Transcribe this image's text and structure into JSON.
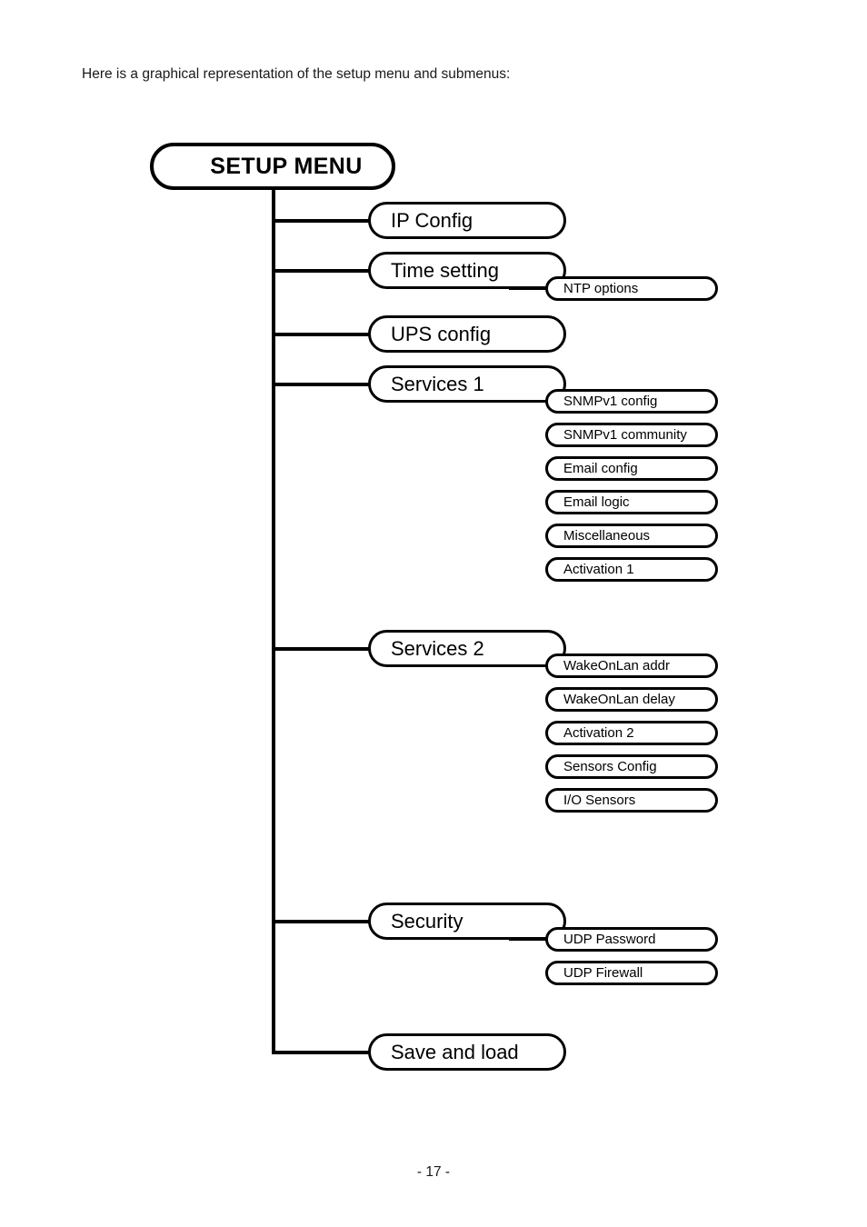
{
  "document": {
    "intro_text": "Here is a graphical representation of the setup menu and submenus:",
    "page_number": "- 17 -"
  },
  "diagram": {
    "root": {
      "label": "SETUP MENU"
    },
    "menu": [
      {
        "label": "IP Config",
        "submenu": []
      },
      {
        "label": "Time setting",
        "submenu": [
          "NTP options"
        ]
      },
      {
        "label": "UPS config",
        "submenu": []
      },
      {
        "label": "Services 1",
        "submenu": [
          "SNMPv1 config",
          "SNMPv1 community",
          "Email config",
          "Email logic",
          "Miscellaneous",
          "Activation 1"
        ]
      },
      {
        "label": "Services 2",
        "submenu": [
          "WakeOnLan addr",
          "WakeOnLan delay",
          "Activation 2",
          "Sensors Config",
          "I/O Sensors"
        ]
      },
      {
        "label": "Security",
        "submenu": [
          "UDP Password",
          "UDP Firewall"
        ]
      },
      {
        "label": "Save and load",
        "submenu": []
      }
    ],
    "colors": {
      "stroke": "#000000",
      "fill": "#ffffff",
      "text": "#000000"
    }
  }
}
